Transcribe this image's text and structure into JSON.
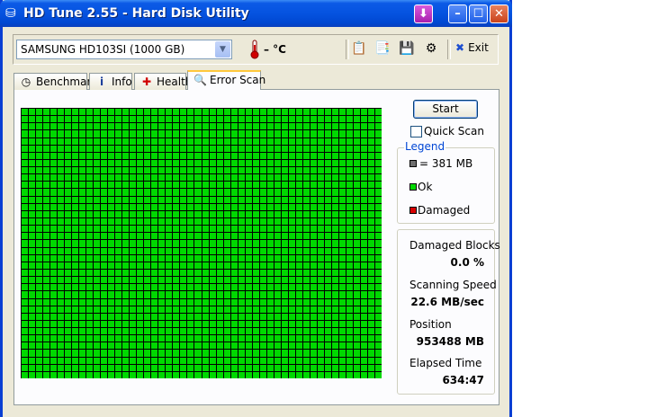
{
  "window": {
    "title": "HD Tune 2.55 - Hard Disk Utility"
  },
  "toolbar": {
    "drive": "SAMSUNG HD103SI (1000 GB)",
    "temperature": "– °C",
    "exit_label": "Exit"
  },
  "tabs": [
    {
      "label": "Benchmark",
      "icon": "stopwatch-icon"
    },
    {
      "label": "Info",
      "icon": "info-icon"
    },
    {
      "label": "Health",
      "icon": "health-cross-icon"
    },
    {
      "label": "Error Scan",
      "icon": "magnifier-icon"
    }
  ],
  "active_tab": "Error Scan",
  "scan": {
    "start_label": "Start",
    "quick_scan_label": "Quick Scan",
    "quick_scan_checked": false,
    "grid_columns": 50,
    "grid_rows": 37,
    "ok_color": "#00d800",
    "damaged_color": "#d80000",
    "block_color": "#6e6e6e"
  },
  "legend": {
    "title": "Legend",
    "block_size": "= 381 MB",
    "ok": "Ok",
    "damaged": "Damaged"
  },
  "stats": {
    "damaged_blocks_label": "Damaged Blocks",
    "damaged_blocks_value": "0.0 %",
    "speed_label": "Scanning Speed",
    "speed_value": "22.6 MB/sec",
    "position_label": "Position",
    "position_value": "953488 MB",
    "elapsed_label": "Elapsed Time",
    "elapsed_value": "634:47"
  }
}
